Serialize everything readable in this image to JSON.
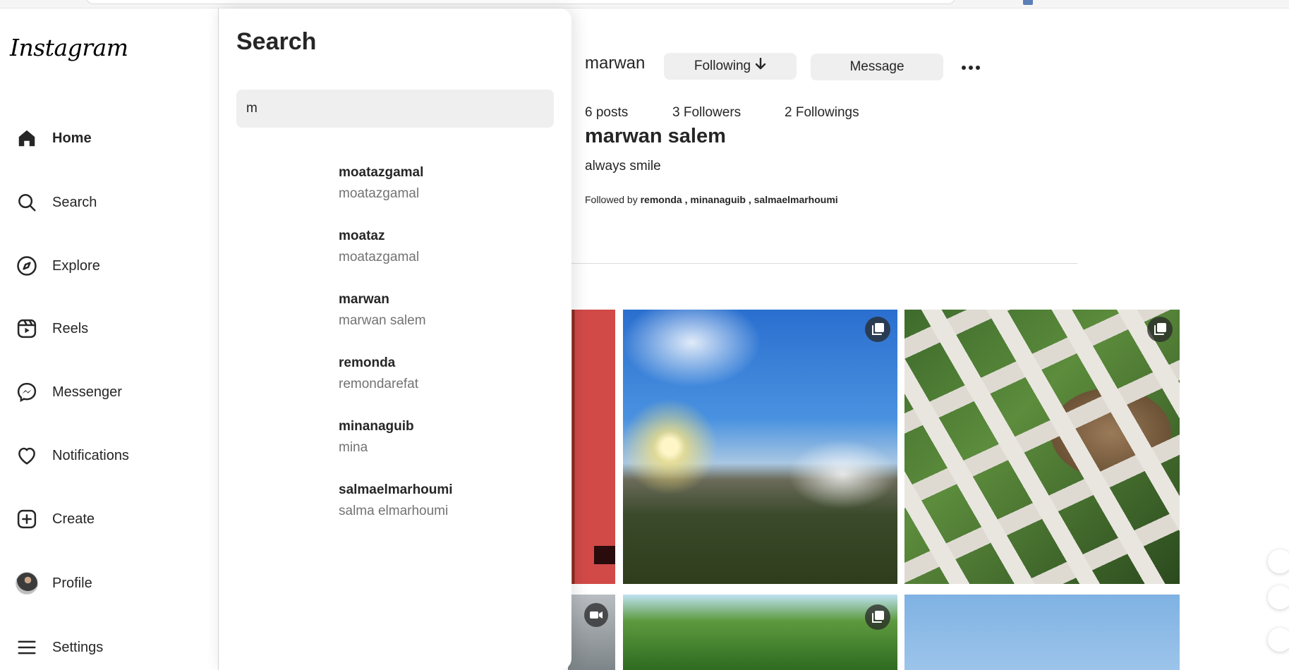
{
  "sidebar": {
    "logo": "Instagram",
    "items": [
      {
        "label": "Home",
        "icon": "home-icon"
      },
      {
        "label": "Search",
        "icon": "search-icon"
      },
      {
        "label": "Explore",
        "icon": "compass-icon"
      },
      {
        "label": "Reels",
        "icon": "reels-icon"
      },
      {
        "label": "Messenger",
        "icon": "messenger-icon"
      },
      {
        "label": "Notifications",
        "icon": "heart-icon"
      },
      {
        "label": "Create",
        "icon": "plus-square-icon"
      },
      {
        "label": "Profile",
        "icon": "avatar"
      },
      {
        "label": "Settings",
        "icon": "menu-icon"
      }
    ]
  },
  "search": {
    "title": "Search",
    "query": "m",
    "results": [
      {
        "username": "moatazgamal",
        "name": "moatazgamal"
      },
      {
        "username": "moataz",
        "name": "moatazgamal"
      },
      {
        "username": "marwan",
        "name": "marwan salem"
      },
      {
        "username": "remonda",
        "name": "remondarefat"
      },
      {
        "username": "minanaguib",
        "name": "mina"
      },
      {
        "username": "salmaelmarhoumi",
        "name": "salma elmarhoumi"
      }
    ]
  },
  "profile": {
    "username": "marwan",
    "following_button": "Following",
    "message_button": "Message",
    "posts": "6 posts",
    "followers": "3 Followers",
    "followings": "2 Followings",
    "full_name": "marwan salem",
    "bio": "always smile",
    "followed_by_prefix": "Followed by",
    "followed_by": [
      "remonda",
      "minanaguib",
      "salmaelmarhoumi"
    ],
    "followed_by_sep": ","
  },
  "colors": {
    "text": "#262626",
    "muted": "#737373",
    "button_bg": "#efefef",
    "input_bg": "#efefef"
  }
}
